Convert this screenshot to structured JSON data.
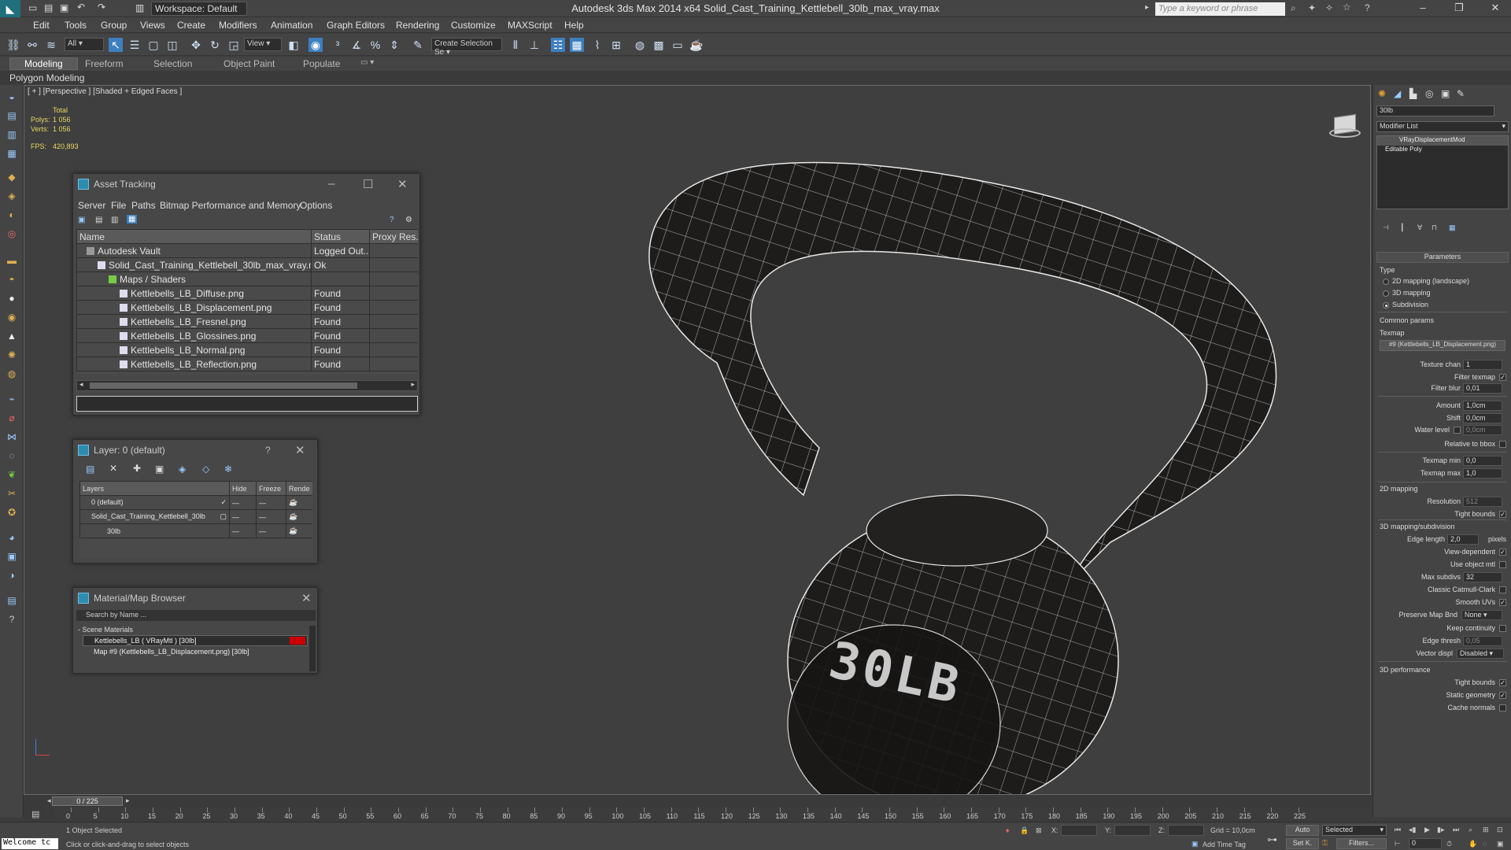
{
  "app": {
    "title": "Autodesk 3ds Max  2014 x64      Solid_Cast_Training_Kettlebell_30lb_max_vray.max",
    "workspace": "Workspace: Default",
    "search_placeholder": "Type a keyword or phrase"
  },
  "menu": [
    "Edit",
    "Tools",
    "Group",
    "Views",
    "Create",
    "Modifiers",
    "Animation",
    "Graph Editors",
    "Rendering",
    "Customize",
    "MAXScript",
    "Help"
  ],
  "toolbar": {
    "filter": "All",
    "refcoord": "View",
    "selset": "Create Selection Se"
  },
  "ribbon": {
    "tabs": [
      "Modeling",
      "Freeform",
      "Selection",
      "Object Paint",
      "Populate"
    ],
    "active": "Modeling",
    "sub": "Polygon Modeling"
  },
  "viewport": {
    "label": "[ + ] [Perspective ] [Shaded + Edged Faces ]",
    "stats_total": "Total",
    "polys_label": "Polys:",
    "polys": "1 056",
    "verts_label": "Verts:",
    "verts": "1 056",
    "fps_label": "FPS:",
    "fps": "420,893",
    "text_30lb": "30LB"
  },
  "asset_tracking": {
    "title": "Asset Tracking",
    "menu": [
      "Server",
      "File",
      "Paths",
      "Bitmap Performance and Memory",
      "Options"
    ],
    "columns": [
      "Name",
      "Status",
      "Proxy Res..."
    ],
    "rows": [
      {
        "name": "Autodesk Vault",
        "status": "Logged Out..."
      },
      {
        "name": "Solid_Cast_Training_Kettlebell_30lb_max_vray.max",
        "status": "Ok"
      },
      {
        "name": "Maps / Shaders",
        "status": ""
      },
      {
        "name": "Kettlebells_LB_Diffuse.png",
        "status": "Found"
      },
      {
        "name": "Kettlebells_LB_Displacement.png",
        "status": "Found"
      },
      {
        "name": "Kettlebells_LB_Fresnel.png",
        "status": "Found"
      },
      {
        "name": "Kettlebells_LB_Glossines.png",
        "status": "Found"
      },
      {
        "name": "Kettlebells_LB_Normal.png",
        "status": "Found"
      },
      {
        "name": "Kettlebells_LB_Reflection.png",
        "status": "Found"
      }
    ]
  },
  "layer_panel": {
    "title": "Layer: 0 (default)",
    "help": "?",
    "columns": [
      "Layers",
      "Hide",
      "Freeze",
      "Rende"
    ],
    "rows": [
      {
        "name": "0 (default)"
      },
      {
        "name": "Solid_Cast_Training_Kettlebell_30lb"
      },
      {
        "name": "30lb"
      }
    ]
  },
  "material_browser": {
    "title": "Material/Map Browser",
    "search": "Search by Name ...",
    "group": "- Scene Materials",
    "items": [
      "Kettlebells_LB  ( VRayMtl ) [30lb]",
      "Map #9 (Kettlebells_LB_Displacement.png) [30lb]"
    ]
  },
  "command_panel": {
    "object_name": "30lb",
    "modifier_list": "Modifier List",
    "stack": [
      "VRayDisplacementMod",
      "Editable Poly"
    ],
    "parameters": "Parameters",
    "type_label": "Type",
    "types": [
      "2D mapping (landscape)",
      "3D mapping",
      "Subdivision"
    ],
    "common_params": "Common params",
    "texmap_label": "Texmap",
    "texmap": "#9 (Kettlebells_LB_Displacement.png)",
    "texture_chan_label": "Texture chan",
    "texture_chan": "1",
    "filter_texmap": "Filter texmap",
    "filter_blur_label": "Filter blur",
    "filter_blur": "0,01",
    "amount_label": "Amount",
    "amount": "1,0cm",
    "shift_label": "Shift",
    "shift": "0,0cm",
    "water_level_label": "Water level",
    "water_level": "0,0cm",
    "relative_bbox": "Relative to bbox",
    "texmap_min_label": "Texmap min",
    "texmap_min": "0,0",
    "texmap_max_label": "Texmap max",
    "texmap_max": "1,0",
    "mapping2d": "2D mapping",
    "resolution_label": "Resolution",
    "resolution": "512",
    "tight_bounds": "Tight bounds",
    "mapping3d": "3D mapping/subdivision",
    "edge_length_label": "Edge length",
    "edge_length": "2,0",
    "pixels": "pixels",
    "view_dependent": "View-dependent",
    "use_object_mtl": "Use object mtl",
    "max_subdivs_label": "Max subdivs",
    "max_subdivs": "32",
    "catmull": "Classic Catmull-Clark",
    "smooth_uvs": "Smooth UVs",
    "preserve_label": "Preserve Map Bnd",
    "preserve": "None",
    "keep_continuity": "Keep continuity",
    "edge_thresh_label": "Edge thresh",
    "edge_thresh": "0,05",
    "vector_displ_label": "Vector displ",
    "vector_displ": "Disabled",
    "performance": "3D performance",
    "tight_bounds2": "Tight bounds",
    "static_geometry": "Static geometry",
    "cache_normals": "Cache normals"
  },
  "timeline": {
    "frame": "0 / 225",
    "ticks": [
      "0",
      "5",
      "10",
      "15",
      "20",
      "25",
      "30",
      "35",
      "40",
      "45",
      "50",
      "55",
      "60",
      "65",
      "70",
      "75",
      "80",
      "85",
      "90",
      "95",
      "100",
      "105",
      "110",
      "115",
      "120",
      "125",
      "130",
      "135",
      "140",
      "145",
      "150",
      "155",
      "160",
      "165",
      "170",
      "175",
      "180",
      "185",
      "190",
      "195",
      "200",
      "205",
      "210",
      "215",
      "220",
      "225"
    ]
  },
  "status": {
    "script": "Welcome tc",
    "selected": "1 Object Selected",
    "prompt": "Click or click-and-drag to select objects",
    "x": "X:",
    "y": "Y:",
    "z": "Z:",
    "grid": "Grid = 10,0cm",
    "add_time_tag": "Add Time Tag",
    "auto": "Auto",
    "selected_drop": "Selected",
    "setk": "Set K.",
    "filters": "Filters...",
    "frame_field": "0"
  }
}
